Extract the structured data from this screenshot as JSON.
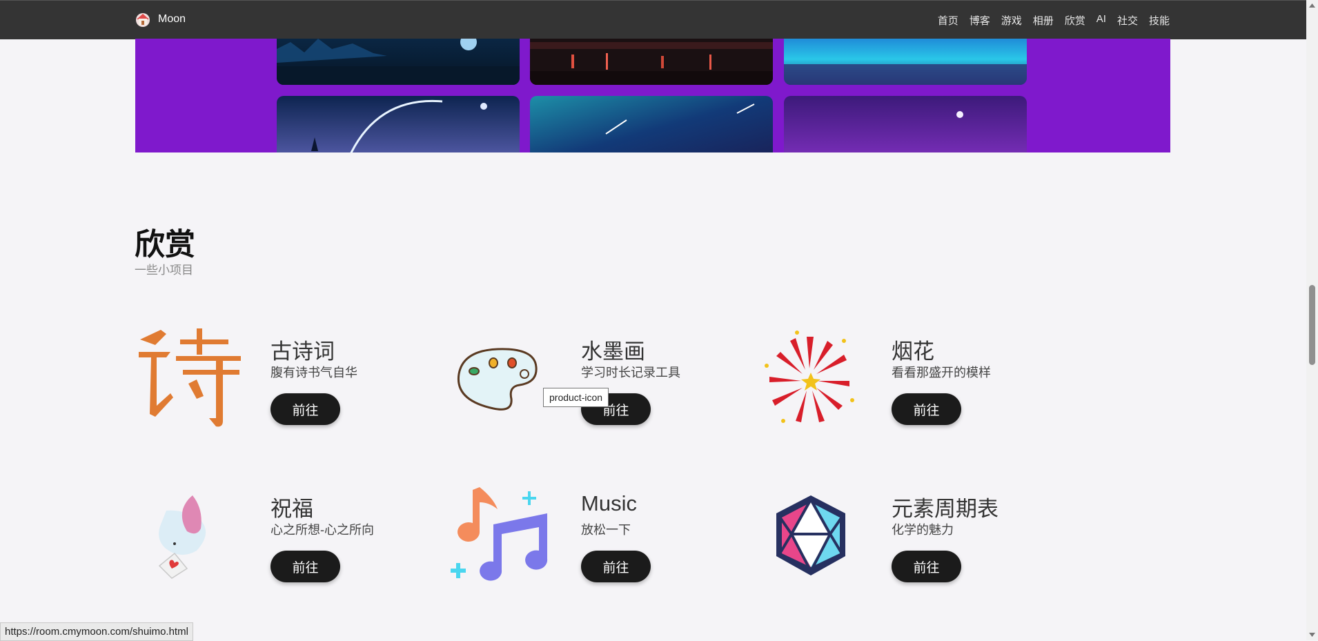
{
  "nav": {
    "brand": "Moon",
    "links": [
      "首页",
      "博客",
      "游戏",
      "相册",
      "欣赏",
      "AI",
      "社交",
      "技能"
    ]
  },
  "section": {
    "title": "欣赏",
    "subtitle": "一些小项目"
  },
  "products": [
    {
      "title": "古诗词",
      "desc": "腹有诗书气自华",
      "button": "前往",
      "icon": "poem-character-icon"
    },
    {
      "title": "水墨画",
      "desc": "学习时长记录工具",
      "button": "前往",
      "icon": "paint-palette-icon"
    },
    {
      "title": "烟花",
      "desc": "看看那盛开的模样",
      "button": "前往",
      "icon": "fireworks-icon"
    },
    {
      "title": "祝福",
      "desc": "心之所想-心之所向",
      "button": "前往",
      "icon": "blessing-bird-icon"
    },
    {
      "title": "Music",
      "desc": "放松一下",
      "button": "前往",
      "icon": "music-notes-icon"
    },
    {
      "title": "元素周期表",
      "desc": "化学的魅力",
      "button": "前往",
      "icon": "icosahedron-icon"
    }
  ],
  "tooltip": "product-icon",
  "status_url": "https://room.cmymoon.com/shuimo.html",
  "colors": {
    "navbar": "#343434",
    "banner": "#7f19cc",
    "button": "#1b1b1b",
    "page_bg": "#f5f4f7"
  }
}
